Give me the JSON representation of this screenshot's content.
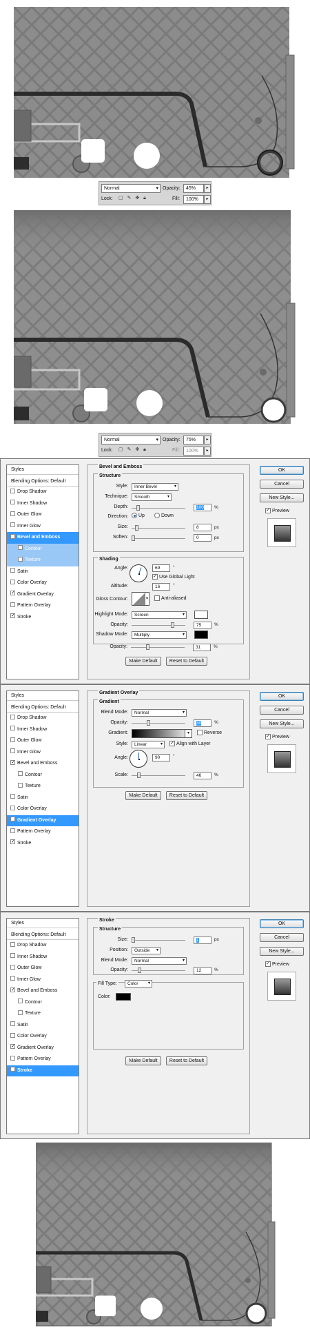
{
  "layers_panel_1": {
    "blend_mode": "Normal",
    "opacity_label": "Opacity:",
    "opacity_value": "45%",
    "lock_label": "Lock:",
    "fill_label": "Fill:",
    "fill_value": "100%"
  },
  "layers_panel_2": {
    "blend_mode": "Normal",
    "opacity_label": "Opacity:",
    "opacity_value": "75%",
    "lock_label": "Lock:",
    "fill_label": "Fill:",
    "fill_value": "100%"
  },
  "styles_list": {
    "heading": "Styles",
    "blending_options": "Blending Options: Default",
    "items": [
      "Drop Shadow",
      "Inner Shadow",
      "Outer Glow",
      "Inner Glow",
      "Bevel and Emboss",
      "Contour",
      "Texture",
      "Satin",
      "Color Overlay",
      "Gradient Overlay",
      "Pattern Overlay",
      "Stroke"
    ]
  },
  "dialog_buttons": {
    "ok": "OK",
    "cancel": "Cancel",
    "new_style": "New Style...",
    "preview": "Preview",
    "make_default": "Make Default",
    "reset_default": "Reset to Default"
  },
  "bevel": {
    "title": "Bevel and Emboss",
    "structure": "Structure",
    "style_label": "Style:",
    "style_value": "Inner Bevel",
    "technique_label": "Technique:",
    "technique_value": "Smooth",
    "depth_label": "Depth:",
    "depth_value": "100",
    "depth_unit": "%",
    "direction_label": "Direction:",
    "direction_up": "Up",
    "direction_down": "Down",
    "size_label": "Size:",
    "size_value": "8",
    "size_unit": "px",
    "soften_label": "Soften:",
    "soften_value": "0",
    "soften_unit": "px",
    "shading": "Shading",
    "angle_label": "Angle:",
    "angle_value": "69",
    "degree": "°",
    "global_light": "Use Global Light",
    "altitude_label": "Altitude:",
    "altitude_value": "16",
    "gloss_label": "Gloss Contour:",
    "anti_aliased": "Anti-aliased",
    "highlight_label": "Highlight Mode:",
    "highlight_value": "Screen",
    "highlight_opacity_label": "Opacity:",
    "highlight_opacity": "75",
    "shadow_label": "Shadow Mode:",
    "shadow_value": "Multiply",
    "shadow_opacity_label": "Opacity:",
    "shadow_opacity": "31",
    "percent": "%",
    "highlight_color": "#ffffff",
    "shadow_color": "#000000"
  },
  "gradient": {
    "title": "Gradient Overlay",
    "group": "Gradient",
    "blend_label": "Blend Mode:",
    "blend_value": "Normal",
    "opacity_label": "Opacity:",
    "opacity_value": "30",
    "gradient_label": "Gradient:",
    "reverse": "Reverse",
    "style_label": "Style:",
    "style_value": "Linear",
    "align": "Align with Layer",
    "angle_label": "Angle:",
    "angle_value": "90",
    "degree": "°",
    "scale_label": "Scale:",
    "scale_value": "46",
    "percent": "%"
  },
  "stroke": {
    "title": "Stroke",
    "structure": "Structure",
    "size_label": "Size:",
    "size_value": "1",
    "size_unit": "px",
    "position_label": "Position:",
    "position_value": "Outside",
    "blend_label": "Blend Mode:",
    "blend_value": "Normal",
    "opacity_label": "Opacity:",
    "opacity_value": "12",
    "percent": "%",
    "fill_type_label": "Fill Type:",
    "fill_type_value": "Color",
    "color_label": "Color:",
    "color_value": "#000000"
  },
  "colors": {
    "selection_blue": "#3399ff",
    "cassette_gray": "#8a8a8a"
  }
}
